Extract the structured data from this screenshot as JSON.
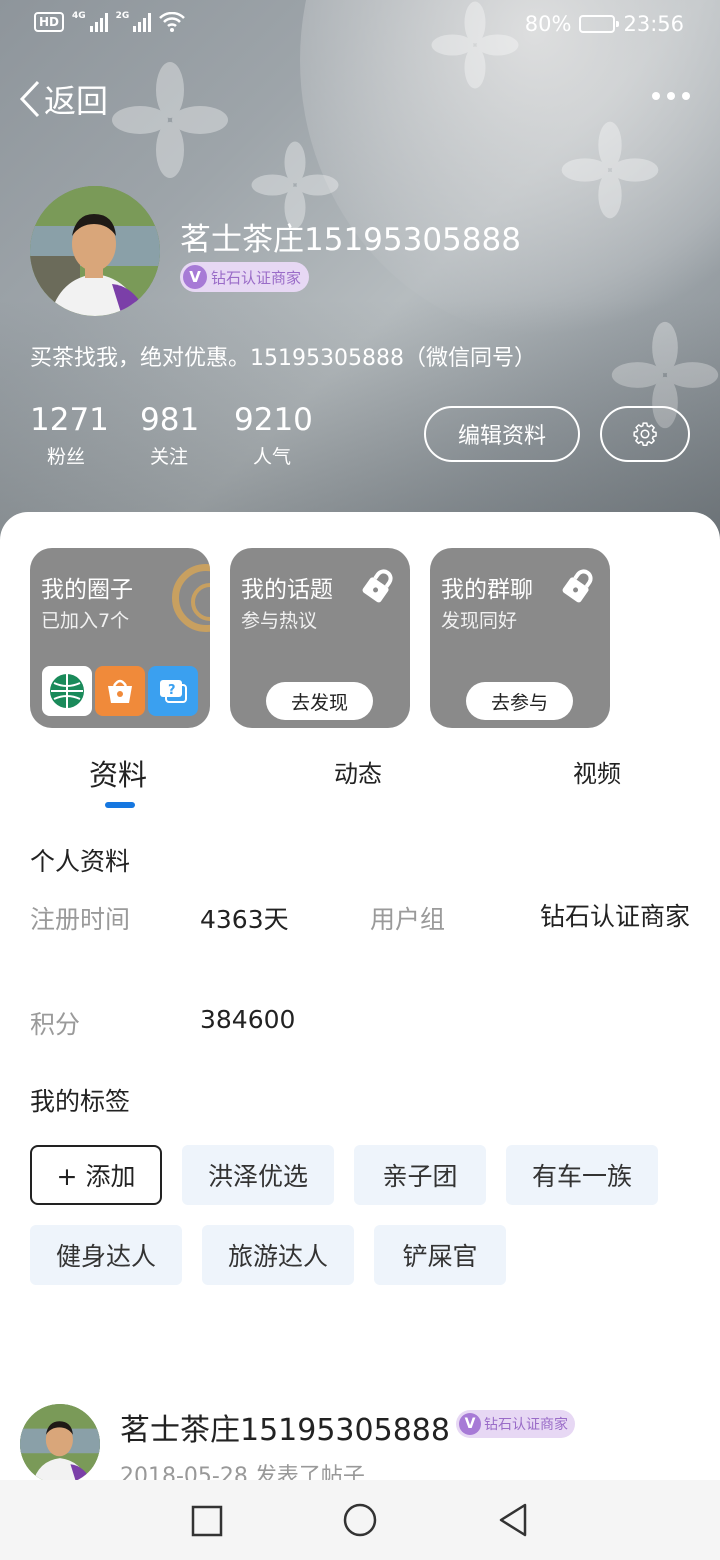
{
  "status_bar": {
    "hd": "HD",
    "net1": "4G",
    "net2": "2G",
    "battery": "80%",
    "battery_level": 0.8,
    "time": "23:56"
  },
  "nav": {
    "back_label": "返回",
    "more_icon": "more-dots-icon"
  },
  "profile": {
    "name": "茗士茶庄15195305888",
    "badge_v": "V",
    "badge": "钻石认证商家",
    "bio": "买茶找我，绝对优惠。15195305888（微信同号）",
    "stats": [
      {
        "value": "1271",
        "label": "粉丝"
      },
      {
        "value": "981",
        "label": "关注"
      },
      {
        "value": "9210",
        "label": "人气"
      }
    ],
    "edit_button": "编辑资料",
    "settings_icon": "gear-icon"
  },
  "cards": [
    {
      "title": "我的圈子",
      "subtitle": "已加入7个"
    },
    {
      "title": "我的话题",
      "subtitle": "参与热议",
      "action": "去发现"
    },
    {
      "title": "我的群聊",
      "subtitle": "发现同好",
      "action": "去参与"
    }
  ],
  "tabs": [
    {
      "label": "资料"
    },
    {
      "label": "动态"
    },
    {
      "label": "视频"
    }
  ],
  "info": {
    "title": "个人资料",
    "reg_label": "注册时间",
    "reg_value": "4363天",
    "group_label": "用户组",
    "group_value": "钻石认证商家",
    "points_label": "积分",
    "points_value": "384600"
  },
  "tags": {
    "title": "我的标签",
    "add": "+ 添加",
    "items": [
      "洪泽优选",
      "亲子团",
      "有车一族",
      "健身达人",
      "旅游达人",
      "铲屎官"
    ]
  },
  "post": {
    "name": "茗士茶庄15195305888",
    "badge_v": "V",
    "badge": "钻石认证商家",
    "meta": "2018-05-28 发表了帖子"
  },
  "colors": {
    "accent": "#1677e0",
    "badge_bg": "#e7d8f4",
    "badge_text": "#9a6cc8",
    "tag_bg": "#eef4fb",
    "card_bg": "#8a8a8a"
  }
}
